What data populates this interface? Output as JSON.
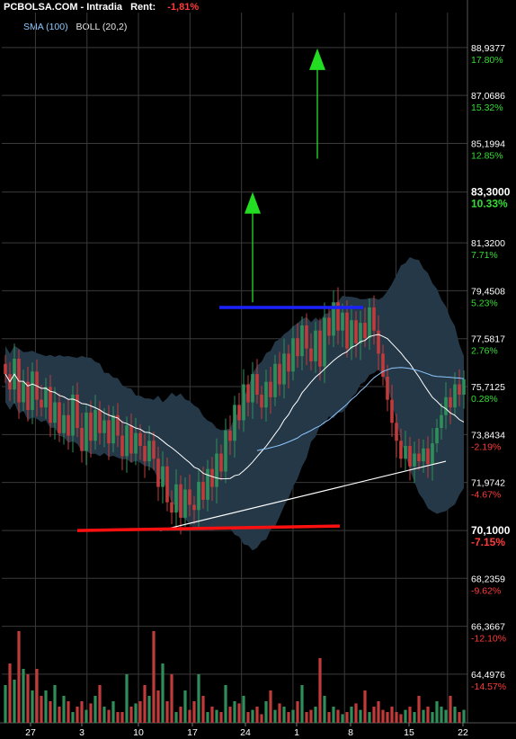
{
  "header": {
    "site": "PCBOLSA.COM",
    "separator": " - ",
    "mode": "Intradia",
    "rent_label": "Rent:",
    "rent_value": "-1,81%"
  },
  "legend": {
    "sma": "SMA (100)",
    "boll": "BOLL (20,2)"
  },
  "colors": {
    "background": "#000000",
    "grid": "#3a3a3a",
    "band_fill": "#253847",
    "up_candle": "#2f8f5b",
    "down_candle": "#c23b3b",
    "price_line": "#ffffff",
    "sma_line": "#8ec8ff",
    "resistance": "#1a22ff",
    "support": "#ff1010",
    "target_arrow": "#22dd22",
    "pos_pct": "#33dd33",
    "neg_pct": "#ff3b3b"
  },
  "chart_data": {
    "type": "candlestick",
    "y_axis": {
      "min": 62.6,
      "max": 90.3,
      "ticks": [
        {
          "price": "88,9377",
          "pct": "17.80%",
          "value": 88.9377
        },
        {
          "price": "87,0686",
          "pct": "15.32%",
          "value": 87.0686
        },
        {
          "price": "85,1994",
          "pct": "12.85%",
          "value": 85.1994
        },
        {
          "price": "83,3000",
          "pct": "10.33%",
          "value": 83.3,
          "emphasis": true
        },
        {
          "price": "81,3200",
          "pct": "7.71%",
          "value": 81.32
        },
        {
          "price": "79,4508",
          "pct": "5.23%",
          "value": 79.4508
        },
        {
          "price": "77,5817",
          "pct": "2.76%",
          "value": 77.5817
        },
        {
          "price": "75,7125",
          "pct": "0.28%",
          "value": 75.7125
        },
        {
          "price": "73,8434",
          "pct": "-2.19%",
          "value": 73.8434
        },
        {
          "price": "71,9742",
          "pct": "-4.67%",
          "value": 71.9742
        },
        {
          "price": "70,1000",
          "pct": "-7.15%",
          "value": 70.1,
          "emphasis": true
        },
        {
          "price": "68,2359",
          "pct": "-9.62%",
          "value": 68.2359
        },
        {
          "price": "66,3667",
          "pct": "-12.10%",
          "value": 66.3667
        },
        {
          "price": "64,4976",
          "pct": "-14.57%",
          "value": 64.4976
        }
      ]
    },
    "x_axis": {
      "ticks": [
        "27",
        "3",
        "10",
        "17",
        "24",
        "1",
        "8",
        "15",
        "22"
      ],
      "bars_per_tick": 5,
      "first_tick_bar": 7,
      "total_bars": 103
    },
    "price_closes": [
      76.2,
      75.6,
      76.8,
      75.1,
      75.9,
      74.8,
      76.3,
      75.2,
      74.9,
      75.7,
      74.3,
      75.1,
      73.9,
      74.6,
      73.8,
      75.4,
      74.1,
      73.2,
      74.7,
      73.6,
      74.8,
      73.9,
      74.4,
      73.5,
      74.6,
      73.8,
      73.0,
      74.2,
      73.1,
      73.9,
      73.4,
      72.8,
      73.6,
      72.9,
      71.8,
      72.6,
      71.2,
      70.8,
      71.9,
      70.6,
      71.7,
      71.1,
      70.9,
      72.0,
      71.3,
      72.5,
      71.8,
      73.1,
      72.4,
      74.0,
      73.6,
      75.0,
      74.4,
      75.8,
      75.1,
      76.2,
      75.4,
      74.9,
      75.9,
      75.3,
      76.6,
      75.8,
      77.0,
      76.3,
      77.6,
      76.9,
      78.1,
      77.2,
      76.7,
      77.9,
      76.5,
      78.4,
      77.7,
      79.0,
      77.9,
      78.6,
      77.2,
      78.3,
      77.4,
      78.2,
      77.6,
      78.8,
      77.9,
      77.0,
      76.1,
      75.2,
      74.3,
      73.6,
      72.9,
      73.4,
      72.6,
      73.1,
      72.8,
      73.3,
      72.7,
      73.5,
      74.1,
      74.6,
      75.3,
      74.9,
      75.8,
      75.4,
      76.0
    ],
    "volumes": [
      0.35,
      0.55,
      0.4,
      0.85,
      0.5,
      0.45,
      0.3,
      0.5,
      0.25,
      0.3,
      0.2,
      0.35,
      0.15,
      0.25,
      0.2,
      0.1,
      0.15,
      0.2,
      0.12,
      0.18,
      0.25,
      0.35,
      0.15,
      0.12,
      0.2,
      0.1,
      0.1,
      0.45,
      0.15,
      0.18,
      0.2,
      0.35,
      0.25,
      0.85,
      0.3,
      0.55,
      0.2,
      0.45,
      0.1,
      0.15,
      0.3,
      0.12,
      0.2,
      0.45,
      0.25,
      0.1,
      0.15,
      0.12,
      0.1,
      0.35,
      0.15,
      0.2,
      0.18,
      0.25,
      0.1,
      0.12,
      0.15,
      0.08,
      0.2,
      0.3,
      0.12,
      0.18,
      0.15,
      0.1,
      0.12,
      0.2,
      0.35,
      0.1,
      0.12,
      0.15,
      0.6,
      0.25,
      0.1,
      0.15,
      0.12,
      0.08,
      0.1,
      0.15,
      0.18,
      0.12,
      0.3,
      0.1,
      0.15,
      0.2,
      0.12,
      0.1,
      0.15,
      0.1,
      0.08,
      0.12,
      0.15,
      0.1,
      0.25,
      0.12,
      0.15,
      0.1,
      0.2,
      0.15,
      0.12,
      0.25,
      0.15,
      0.1,
      0.12
    ],
    "resistance_level": 78.8,
    "support_level": 70.1,
    "trendline": {
      "from": [
        36,
        70.1
      ],
      "to": [
        98,
        72.8
      ]
    },
    "targets": [
      {
        "bar": 71,
        "from": 79.0,
        "to": 83.3
      },
      {
        "bar": 89,
        "from": 84.6,
        "to": 88.9
      }
    ]
  }
}
